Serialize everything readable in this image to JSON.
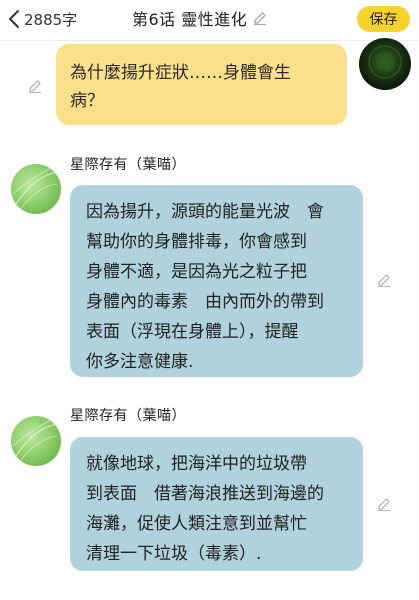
{
  "header": {
    "word_count": "2885字",
    "title": "第6话 靈性進化",
    "save_label": "保存"
  },
  "messages": [
    {
      "type": "own",
      "lines": [
        "為什麼揚升症狀……身體會生",
        "病？"
      ]
    },
    {
      "type": "other",
      "sender": "星際存有（葉喵）",
      "lines": [
        "因為揚升，源頭的能量光波　會",
        "幫助你的身體排毒，你會感到",
        "身體不適，是因為光之粒子把",
        "身體內的毒素　由內而外的帶到",
        "表面（浮現在身體上），提醒",
        "你多注意健康."
      ]
    },
    {
      "type": "other",
      "sender": "星際存有（葉喵）",
      "lines": [
        "就像地球，把海洋中的垃圾帶",
        "到表面　借著海浪推送到海邊的",
        "海灘，促使人類注意到並幫忙",
        "清理一下垃圾（毒素）."
      ]
    }
  ],
  "colors": {
    "save_button": "#f6d32a",
    "own_bubble": "#fbe08b",
    "other_bubble": "#afd2dc"
  },
  "icons": [
    "back-chevron-icon",
    "pencil-edit-icon"
  ]
}
